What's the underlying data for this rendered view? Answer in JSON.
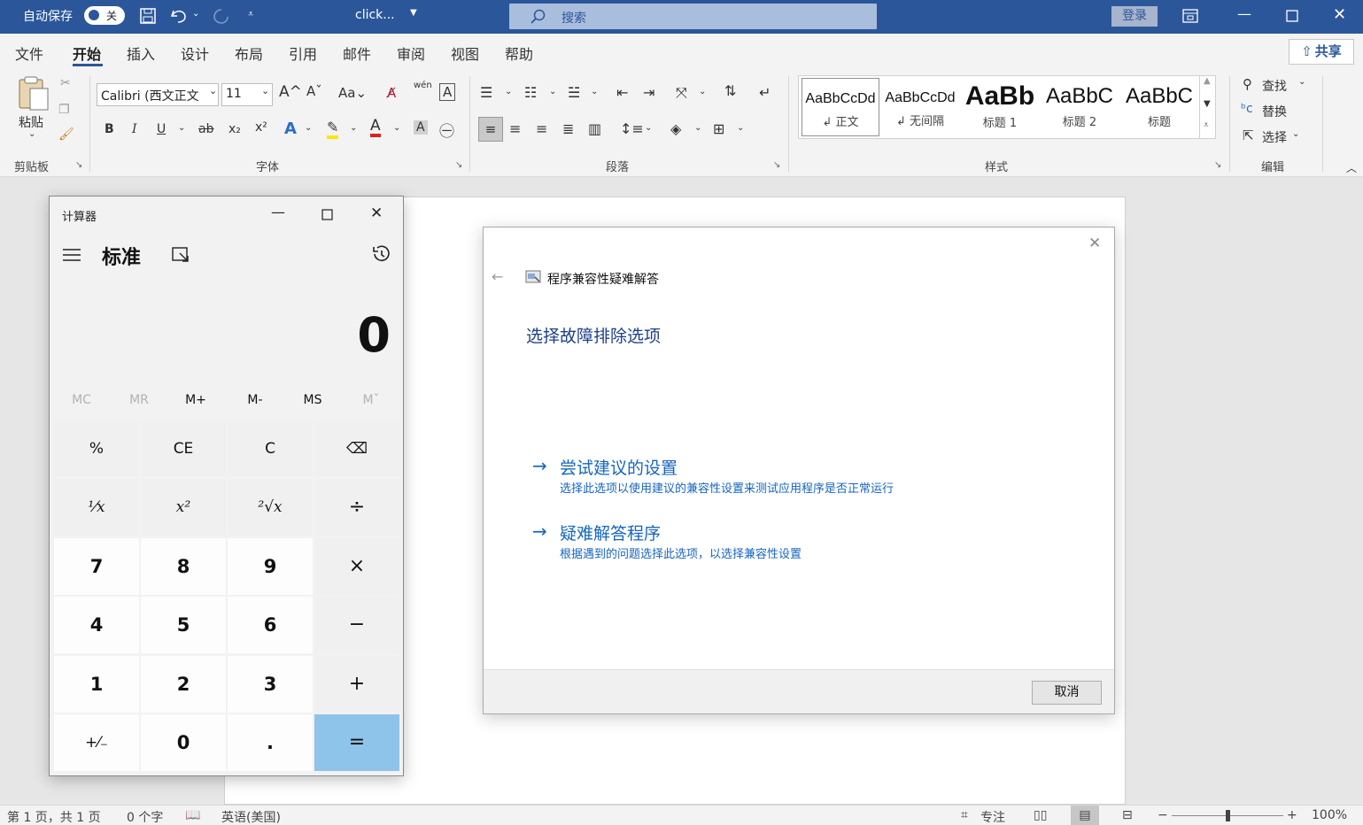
{
  "titlebar": {
    "autosave_label": "自动保存",
    "autosave_state": "关",
    "filename": "click...",
    "search_placeholder": "搜索",
    "login": "登录"
  },
  "menu": {
    "items": [
      "文件",
      "开始",
      "插入",
      "设计",
      "布局",
      "引用",
      "邮件",
      "审阅",
      "视图",
      "帮助"
    ],
    "share": "共享"
  },
  "ribbon": {
    "clipboard": {
      "paste": "粘贴",
      "group": "剪贴板"
    },
    "font": {
      "name": "Calibri (西文正文",
      "size": "11",
      "group": "字体",
      "pinyin": "wén"
    },
    "paragraph": {
      "group": "段落"
    },
    "styles": {
      "group": "样式",
      "items": [
        {
          "sample": "AaBbCcDd",
          "name": "↲ 正文"
        },
        {
          "sample": "AaBbCcDd",
          "name": "↲ 无间隔"
        },
        {
          "sample": "AaBb",
          "name": "标题 1"
        },
        {
          "sample": "AaBbC",
          "name": "标题 2"
        },
        {
          "sample": "AaBbC",
          "name": "标题"
        }
      ]
    },
    "editing": {
      "find": "查找",
      "replace": "替换",
      "select": "选择",
      "group": "编辑"
    }
  },
  "calculator": {
    "window_title": "计算器",
    "mode": "标准",
    "display": "0",
    "memory": [
      {
        "label": "MC",
        "enabled": false
      },
      {
        "label": "MR",
        "enabled": false
      },
      {
        "label": "M+",
        "enabled": true
      },
      {
        "label": "M-",
        "enabled": true
      },
      {
        "label": "MS",
        "enabled": true
      },
      {
        "label": "Mˇ",
        "enabled": false
      }
    ],
    "keys": [
      [
        "%",
        "CE",
        "C",
        "⌫"
      ],
      [
        "¹⁄x",
        "x²",
        "²√x",
        "÷"
      ],
      [
        "7",
        "8",
        "9",
        "×"
      ],
      [
        "4",
        "5",
        "6",
        "−"
      ],
      [
        "1",
        "2",
        "3",
        "+"
      ],
      [
        "+⁄₋",
        "0",
        ".",
        "="
      ]
    ]
  },
  "dialog": {
    "title": "程序兼容性疑难解答",
    "heading": "选择故障排除选项",
    "options": [
      {
        "title": "尝试建议的设置",
        "desc": "选择此选项以使用建议的兼容性设置来测试应用程序是否正常运行"
      },
      {
        "title": "疑难解答程序",
        "desc": "根据遇到的问题选择此选项，以选择兼容性设置"
      }
    ],
    "cancel": "取消"
  },
  "statusbar": {
    "page": "第 1 页，共 1 页",
    "words": "0 个字",
    "language": "英语(美国)",
    "focus": "专注",
    "zoom": "100%"
  }
}
